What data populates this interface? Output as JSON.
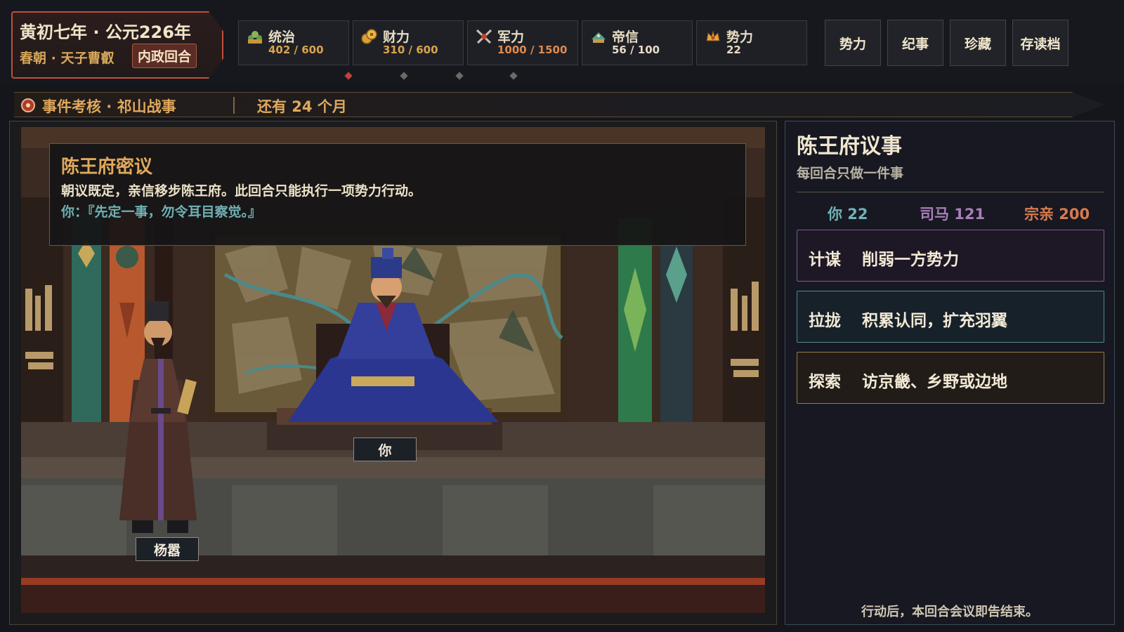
{
  "era": {
    "title": "黄初七年 · 公元226年",
    "court": "春朝 · 天子曹叡",
    "phase_badge": "内政回合"
  },
  "stats": [
    {
      "name": "统治",
      "value": "402 / 600",
      "icon": "governance-icon",
      "value_color": "#d9a44e"
    },
    {
      "name": "财力",
      "value": "310 / 600",
      "icon": "coins-icon",
      "value_color": "#d9a44e"
    },
    {
      "name": "军力",
      "value": "1000 / 1500",
      "icon": "crossed-swords-icon",
      "value_color": "#e0894c"
    },
    {
      "name": "帝信",
      "value": "56 / 100",
      "icon": "imperial-trust-icon",
      "value_color": "#e6dcc4"
    },
    {
      "name": "势力",
      "value": "22",
      "icon": "faction-crown-icon",
      "value_color": "#e6dcc4"
    }
  ],
  "nav": {
    "faction": "势力",
    "chronicle": "纪事",
    "treasures": "珍藏",
    "save_load": "存读档"
  },
  "event": {
    "label": "事件考核 · 祁山战事",
    "remaining": "还有 24 个月"
  },
  "dialog": {
    "title": "陈王府密议",
    "narration": "朝议既定，亲信移步陈王府。此回合只能执行一项势力行动。",
    "speech": "你：『先定一事，勿令耳目察觉。』"
  },
  "characters": {
    "player": "你",
    "advisor": "杨嚣"
  },
  "panel": {
    "title": "陈王府议事",
    "subtitle": "每回合只做一件事",
    "scores": [
      {
        "label": "你 22",
        "color": "#6fb3b8"
      },
      {
        "label": "司马 121",
        "color": "#a87fb8"
      },
      {
        "label": "宗亲 200",
        "color": "#d87a4e"
      }
    ],
    "options": [
      {
        "key": "计谋",
        "desc": "削弱一方势力",
        "border": "#7a5c8a",
        "bg": "#1e1826"
      },
      {
        "key": "拉拢",
        "desc": "积累认同，扩充羽翼",
        "border": "#4d8a8e",
        "bg": "#17212a"
      },
      {
        "key": "探索",
        "desc": "访京畿、乡野或边地",
        "border": "#9a7a4a",
        "bg": "#211c18"
      }
    ],
    "footer": "行动后，本回合会议即告结束。"
  },
  "colors": {
    "accent_gold": "#e0a85c",
    "accent_red": "#c0503c"
  }
}
